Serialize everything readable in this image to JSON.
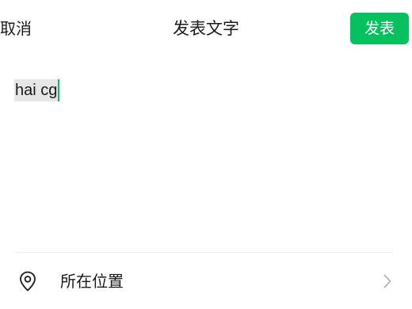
{
  "nav": {
    "cancel_label": "取消",
    "title": "发表文字",
    "publish_label": "发表"
  },
  "editor": {
    "text": "hai cg"
  },
  "location": {
    "label": "所在位置",
    "icon": "location-pin-icon",
    "chevron": "chevron-right-icon"
  },
  "colors": {
    "accent": "#07c160",
    "text": "#1a1a1a",
    "selection": "#e6e6e6",
    "muted": "#b2b2b2",
    "divider": "#ececec"
  }
}
